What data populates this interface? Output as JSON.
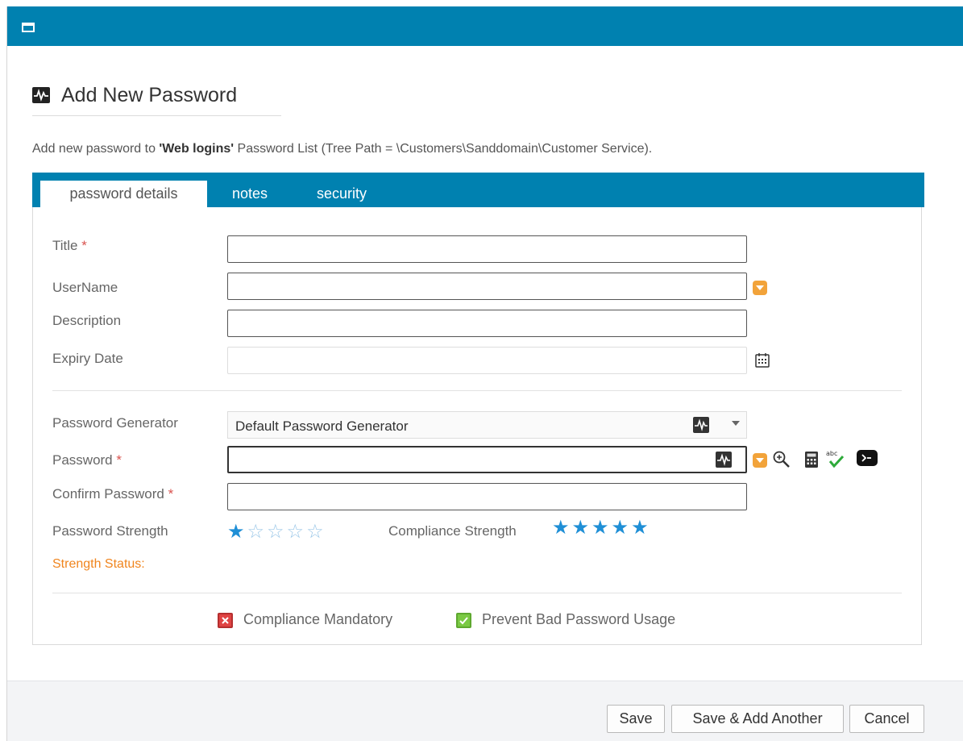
{
  "dialog": {
    "heading": "Add New Password",
    "intro_prefix": "Add new password to ",
    "intro_list": "'Web logins'",
    "intro_suffix": " Password List (Tree Path = \\Customers\\Sanddomain\\Customer Service)."
  },
  "tabs": [
    {
      "label": "password details",
      "active": true
    },
    {
      "label": "notes",
      "active": false
    },
    {
      "label": "security",
      "active": false
    }
  ],
  "form": {
    "title_label": "Title",
    "username_label": "UserName",
    "description_label": "Description",
    "expiry_label": "Expiry Date",
    "generator_label": "Password Generator",
    "generator_value": "Default Password Generator",
    "password_label": "Password",
    "confirm_label": "Confirm Password",
    "strength_label": "Password Strength",
    "compliance_label": "Compliance Strength",
    "status_label": "Strength Status:",
    "required_mark": "*",
    "title_value": "",
    "username_value": "",
    "description_value": "",
    "expiry_value": "",
    "password_value": "",
    "confirm_value": ""
  },
  "strength": {
    "password_stars": 1,
    "compliance_stars": 5,
    "max_stars": 5
  },
  "checks": {
    "compliance_mandatory": {
      "label": "Compliance Mandatory",
      "checked": false
    },
    "prevent_bad": {
      "label": "Prevent Bad Password Usage",
      "checked": true
    }
  },
  "buttons": {
    "save": "Save",
    "save_add": "Save & Add Another",
    "cancel": "Cancel"
  },
  "colors": {
    "accent": "#0081b0",
    "status": "#f0851e",
    "star": "#1f8fd6"
  }
}
